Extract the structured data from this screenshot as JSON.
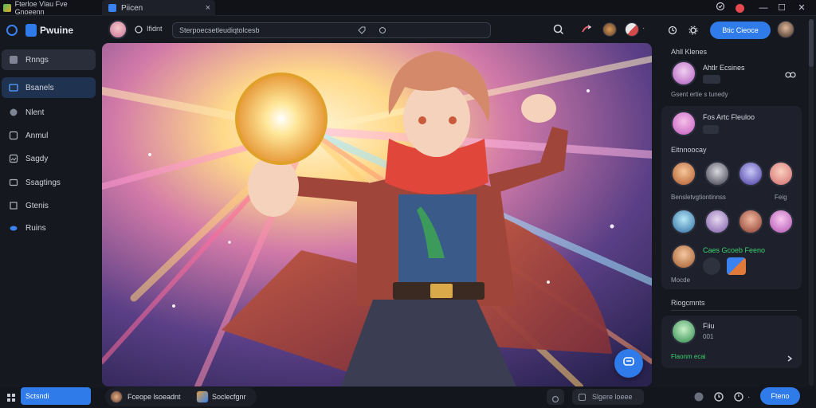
{
  "titlebar": {
    "app_tab": "Fterloe Vlau Fve Gnoeenn",
    "active_tab": "Piicen",
    "close_glyph": "×",
    "min_glyph": "—",
    "max_glyph": "☐",
    "win_close_glyph": "✕"
  },
  "sidebar": {
    "brand": "Pwuine",
    "items": [
      {
        "label": "Rnngs",
        "icon": "image-icon"
      },
      {
        "label": "Bsanels",
        "icon": "folder-icon"
      },
      {
        "label": "Nlent",
        "icon": "bookmark-icon"
      },
      {
        "label": "Anmul",
        "icon": "album-icon"
      },
      {
        "label": "Sagdy",
        "icon": "gallery-icon"
      },
      {
        "label": "Ssagtings",
        "icon": "settings-icon"
      },
      {
        "label": "Gtenis",
        "icon": "tools-icon"
      },
      {
        "label": "Ruins",
        "icon": "cloud-icon"
      }
    ],
    "footer_button": "Sctsndi"
  },
  "topbar": {
    "section": "Ifidnt",
    "search_value": "Sterpoecsetleudiqtolcesb",
    "primary_button": "Btic Cieoce"
  },
  "right_panel": {
    "section1_title": "Ahll Klenes",
    "user1_name": "Ahtlr Ecsines",
    "user1_caption": "Gsent ertie s tunedy",
    "card_title": "Fos Artc Fleuloo",
    "card_section": "Eitnnoocay",
    "grid_caption_left": "Bensletvgtiontinnss",
    "grid_caption_right": "Feig",
    "card_footer_name": "Caes Gcoeb Feeno",
    "card_footer_sub": "Mocde",
    "section2_title": "Riogcmnts",
    "user2_name": "Fiiu",
    "user2_sub": "001",
    "user2_status": "Flaonm ecai"
  },
  "bottombar": {
    "left_item1": "Fceope lsoeadnt",
    "left_item2": "Soclecfgnr",
    "center_field": "Slgere loeee",
    "primary_button": "Fteno"
  },
  "colors": {
    "accent": "#2f7be9",
    "background": "#16181f",
    "status_green": "#3bd16f"
  }
}
